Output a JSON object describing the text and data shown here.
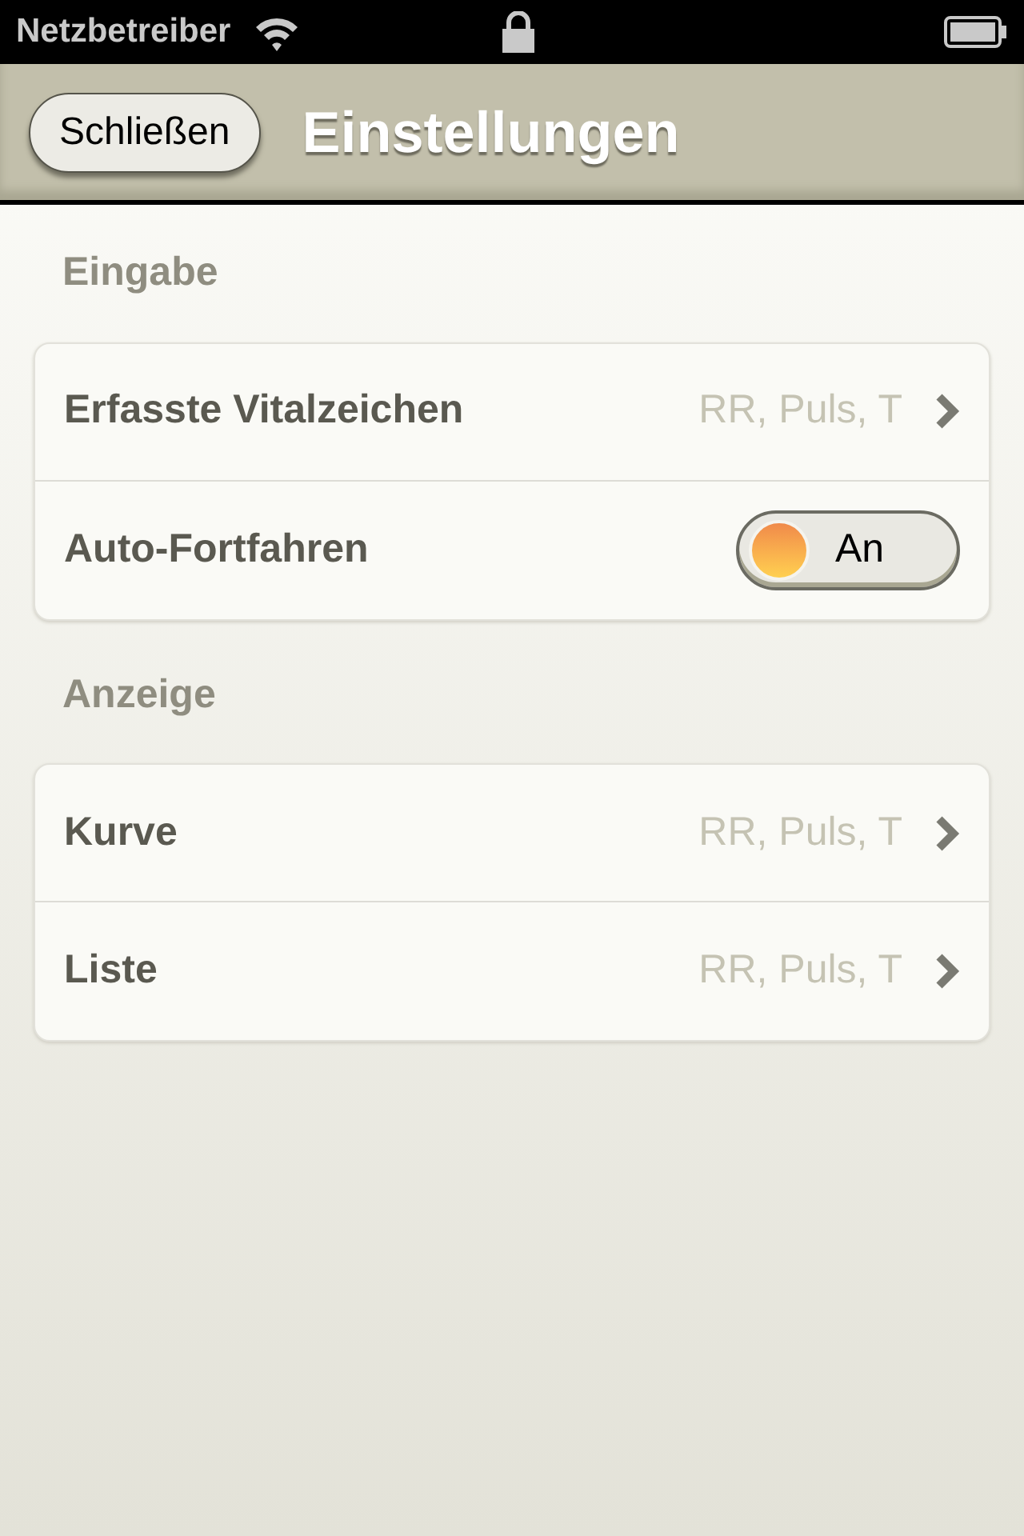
{
  "status_bar": {
    "carrier": "Netzbetreiber"
  },
  "nav": {
    "back_button": "Schließen",
    "title": "Einstellungen"
  },
  "sections": [
    {
      "header": "Eingabe",
      "rows": [
        {
          "kind": "disclosure",
          "label": "Erfasste Vitalzeichen",
          "value": "RR, Puls, T"
        },
        {
          "kind": "toggle",
          "label": "Auto-Fortfahren",
          "on": true,
          "toggle_text": "An"
        }
      ]
    },
    {
      "header": "Anzeige",
      "rows": [
        {
          "kind": "disclosure",
          "label": "Kurve",
          "value": "RR, Puls, T"
        },
        {
          "kind": "disclosure",
          "label": "Liste",
          "value": "RR, Puls, T"
        }
      ]
    }
  ]
}
